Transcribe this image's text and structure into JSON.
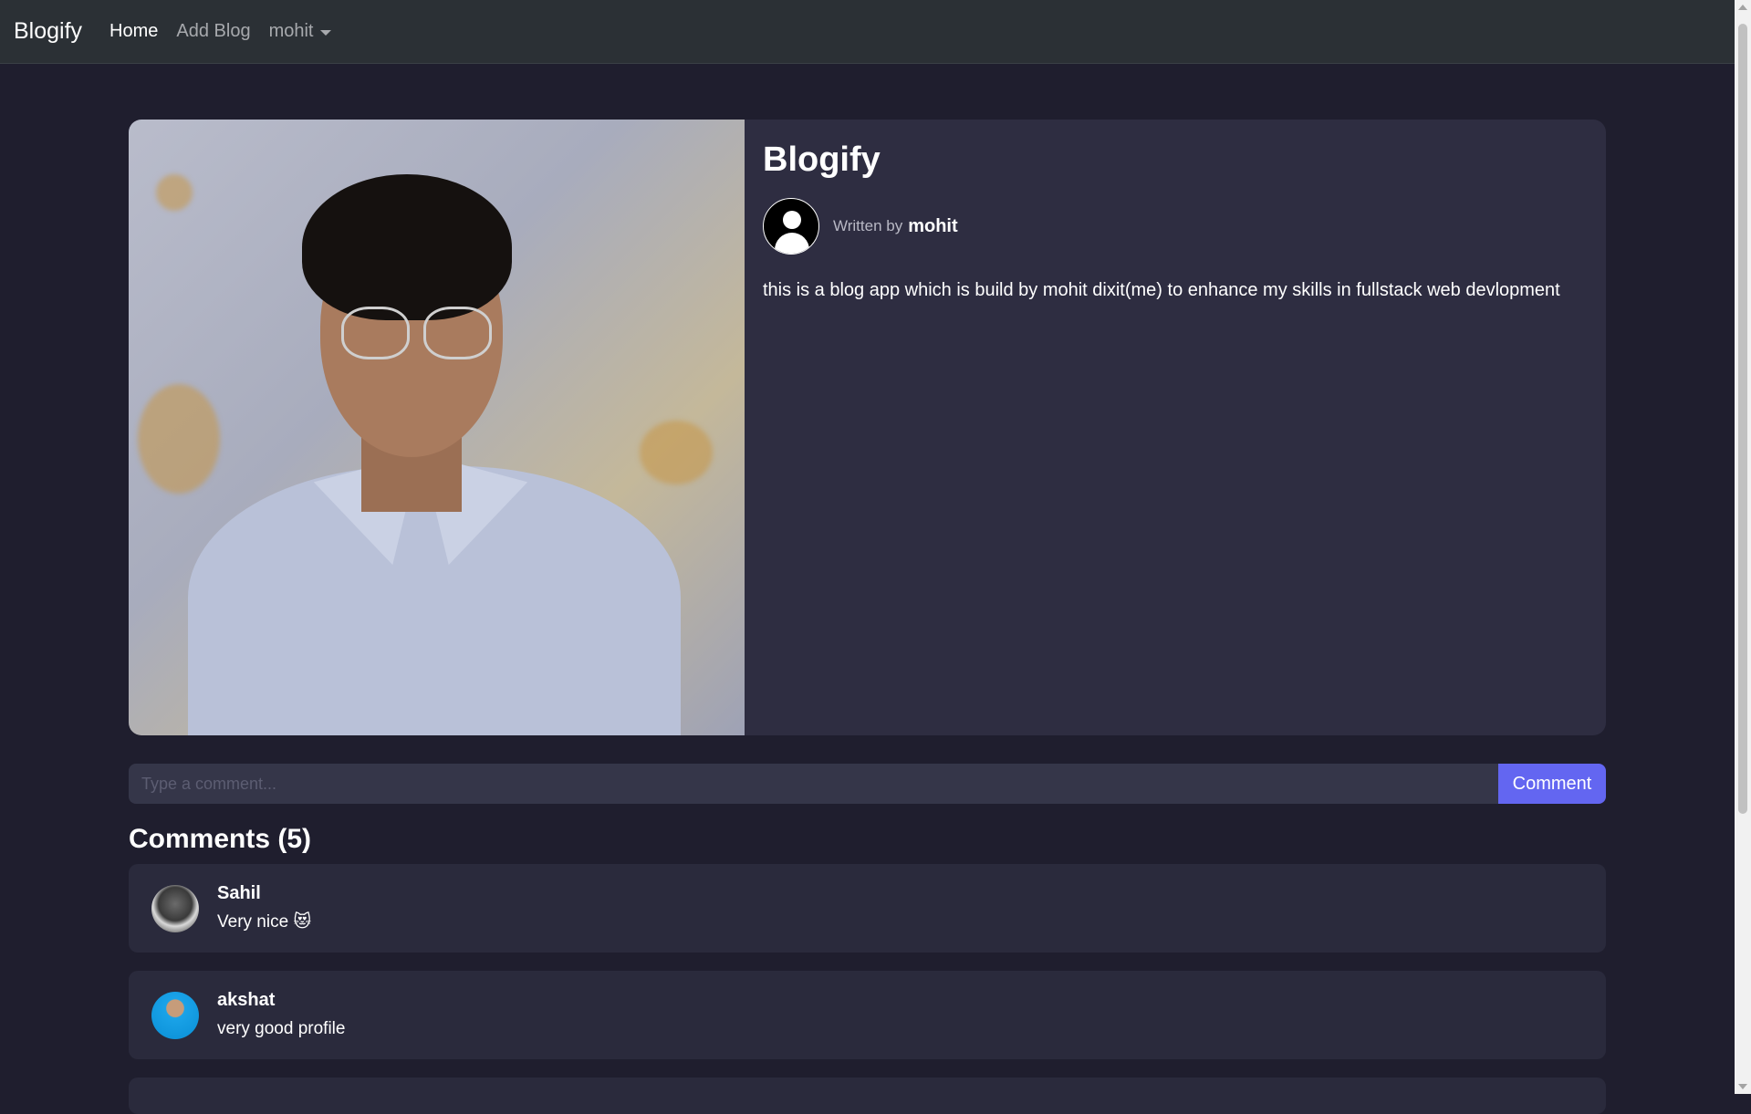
{
  "navbar": {
    "brand": "Blogify",
    "links": [
      {
        "label": "Home",
        "active": true
      },
      {
        "label": "Add Blog",
        "active": false
      }
    ],
    "user_menu": "mohit"
  },
  "blog": {
    "title": "Blogify",
    "written_by_label": "Written by",
    "author": "mohit",
    "body": "this is a blog app which is build by mohit dixit(me) to enhance my skills in fullstack web devlopment"
  },
  "comment_form": {
    "placeholder": "Type a comment...",
    "button_label": "Comment"
  },
  "comments": {
    "heading": "Comments (5)",
    "items": [
      {
        "author": "Sahil",
        "text": "Very nice 😻"
      },
      {
        "author": "akshat",
        "text": "very good profile"
      }
    ]
  },
  "colors": {
    "page_bg": "#1f1e2e",
    "navbar_bg": "#2b3035",
    "card_bg": "#2e2d41",
    "accent": "#6366f1"
  },
  "icons": {
    "author_avatar": "user-silhouette-icon",
    "dropdown": "caret-down-icon"
  }
}
